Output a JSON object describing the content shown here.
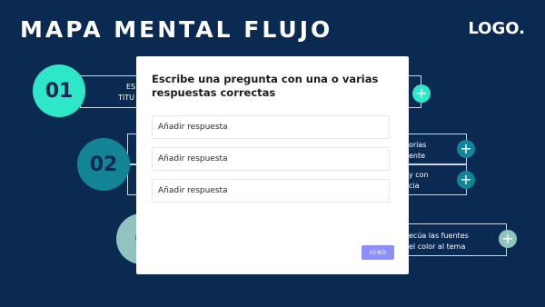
{
  "header": {
    "title": "MAPA MENTAL FLUJO",
    "logo": "LOGO."
  },
  "steps": [
    {
      "number": "01",
      "text": "ES\nTITU"
    },
    {
      "number": "02",
      "text_a": "orias\nente",
      "text_b": "y con\ncia"
    },
    {
      "number": "0",
      "text": "ecúa las fuentes\nel color al tema"
    }
  ],
  "modal": {
    "title": "Escribe una pregunta con una o varias respuestas correctas",
    "answer_placeholder": "Añadir respuesta",
    "send_label": "SEND"
  },
  "colors": {
    "background": "#0b2a52",
    "step1": "#2ee6c8",
    "step2": "#138396",
    "step3": "#8fc5be",
    "send": "#8c8ff7"
  }
}
